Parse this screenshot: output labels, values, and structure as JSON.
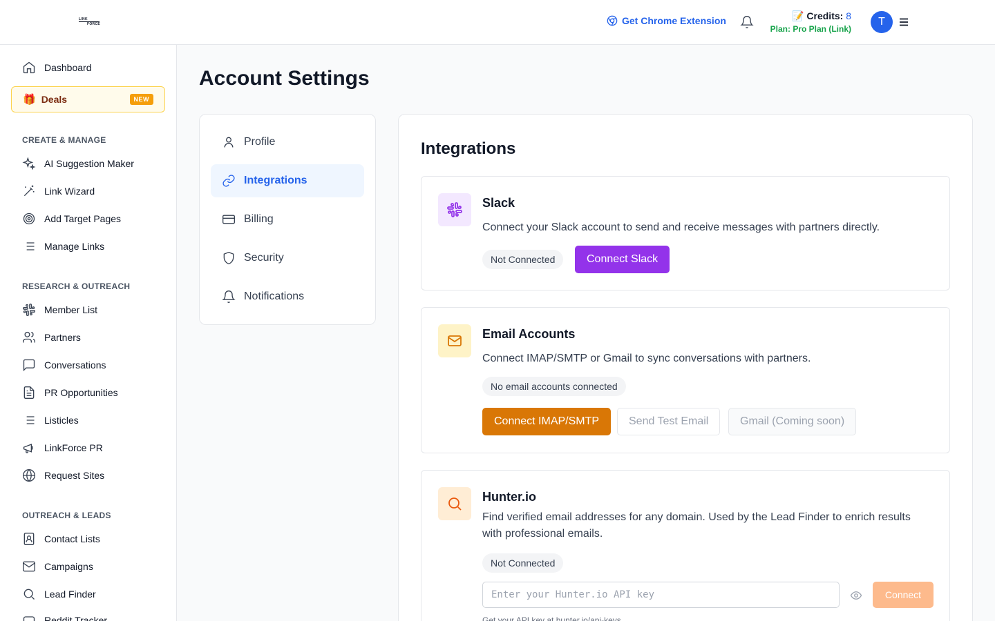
{
  "header": {
    "logo_top": "LINK",
    "logo_bottom": "FORCE",
    "chrome_extension": "Get Chrome Extension",
    "credits_emoji": "📝",
    "credits_label": "Credits:",
    "credits_value": "8",
    "plan": "Plan: Pro Plan (Link)",
    "avatar_initial": "T"
  },
  "sidebar": {
    "dashboard": "Dashboard",
    "deals": {
      "label": "Deals",
      "badge": "NEW",
      "icon": "🎁"
    },
    "sections": [
      {
        "label": "CREATE & MANAGE",
        "items": [
          "AI Suggestion Maker",
          "Link Wizard",
          "Add Target Pages",
          "Manage Links"
        ]
      },
      {
        "label": "RESEARCH & OUTREACH",
        "items": [
          "Member List",
          "Partners",
          "Conversations",
          "PR Opportunities",
          "Listicles",
          "LinkForce PR",
          "Request Sites"
        ]
      },
      {
        "label": "OUTREACH & LEADS",
        "items": [
          "Contact Lists",
          "Campaigns",
          "Lead Finder",
          "Reddit Tracker"
        ]
      }
    ]
  },
  "main": {
    "title": "Account Settings",
    "settings_nav": [
      "Profile",
      "Integrations",
      "Billing",
      "Security",
      "Notifications"
    ],
    "active_tab": "Integrations",
    "panel_title": "Integrations",
    "slack": {
      "title": "Slack",
      "description": "Connect your Slack account to send and receive messages with partners directly.",
      "status": "Not Connected",
      "button": "Connect Slack"
    },
    "email": {
      "title": "Email Accounts",
      "description": "Connect IMAP/SMTP or Gmail to sync conversations with partners.",
      "status": "No email accounts connected",
      "btn_connect": "Connect IMAP/SMTP",
      "btn_test": "Send Test Email",
      "btn_gmail": "Gmail (Coming soon)"
    },
    "hunter": {
      "title": "Hunter.io",
      "description": "Find verified email addresses for any domain. Used by the Lead Finder to enrich results with professional emails.",
      "status": "Not Connected",
      "placeholder": "Enter your Hunter.io API key",
      "button": "Connect",
      "hint": "Get your API key at hunter.io/api-keys"
    }
  },
  "colors": {
    "accent": "#2563eb",
    "slack_purple": "#9333ea",
    "email_amber": "#d97706",
    "hunter_orange": "#ea580c",
    "plan_green": "#16a34a"
  }
}
